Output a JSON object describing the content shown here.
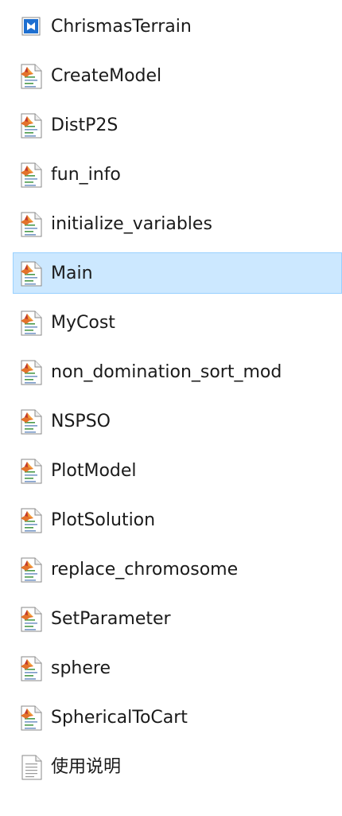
{
  "files": [
    {
      "name": "ChrismasTerrain",
      "icon": "matlab-figure-icon",
      "selected": false
    },
    {
      "name": "CreateModel",
      "icon": "matlab-m-file-icon",
      "selected": false
    },
    {
      "name": "DistP2S",
      "icon": "matlab-m-file-icon",
      "selected": false
    },
    {
      "name": "fun_info",
      "icon": "matlab-m-file-icon",
      "selected": false
    },
    {
      "name": "initialize_variables",
      "icon": "matlab-m-file-icon",
      "selected": false
    },
    {
      "name": "Main",
      "icon": "matlab-m-file-icon",
      "selected": true
    },
    {
      "name": "MyCost",
      "icon": "matlab-m-file-icon",
      "selected": false
    },
    {
      "name": "non_domination_sort_mod",
      "icon": "matlab-m-file-icon",
      "selected": false
    },
    {
      "name": "NSPSO",
      "icon": "matlab-m-file-icon",
      "selected": false
    },
    {
      "name": "PlotModel",
      "icon": "matlab-m-file-icon",
      "selected": false
    },
    {
      "name": "PlotSolution",
      "icon": "matlab-m-file-icon",
      "selected": false
    },
    {
      "name": "replace_chromosome",
      "icon": "matlab-m-file-icon",
      "selected": false
    },
    {
      "name": "SetParameter",
      "icon": "matlab-m-file-icon",
      "selected": false
    },
    {
      "name": "sphere",
      "icon": "matlab-m-file-icon",
      "selected": false
    },
    {
      "name": "SphericalToCart",
      "icon": "matlab-m-file-icon",
      "selected": false
    },
    {
      "name": "使用说明",
      "icon": "text-document-icon",
      "selected": false
    }
  ],
  "colors": {
    "selection_background": "#cce8ff",
    "selection_border": "#99d1ff",
    "text": "#1a1a1a"
  }
}
